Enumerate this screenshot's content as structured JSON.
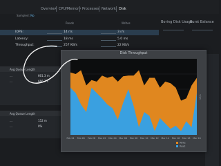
{
  "header": {
    "tabs": [
      {
        "label": "Overview",
        "active": false
      },
      {
        "label": "CPU/Memory",
        "active": false
      },
      {
        "label": "Processes",
        "active": false
      },
      {
        "label": "Network",
        "active": false
      },
      {
        "label": "Disk",
        "active": true
      }
    ],
    "sampled_label": "Sampled:",
    "sampled_value": "No"
  },
  "metrics": {
    "col_reads": "Reads",
    "col_writes": "Writes",
    "rows": [
      {
        "label": "IOPS:",
        "reads": "14 r/s",
        "writes": "3 r/s"
      },
      {
        "label": "Latency:",
        "reads": "18 ms",
        "writes": "5.0 ms"
      },
      {
        "label": "Throughput:",
        "reads": "257 KB/s",
        "writes": "22 KB/s"
      }
    ]
  },
  "right_headers": {
    "boring_disk_usage": "Boring Disk Usage",
    "burst_balance": "Burst Balance"
  },
  "queue_panel": {
    "header": "Avg Queue Length",
    "rows": [
      {
        "label": "…",
        "value": "661.3 m"
      },
      {
        "label": "…",
        "value": "666.7 s"
      }
    ]
  },
  "queue_panel_2": {
    "header": "Avg Queue Length",
    "rows": [
      {
        "label": "…",
        "value": "152 m"
      },
      {
        "label": "…",
        "value": "0%"
      }
    ]
  },
  "modal": {
    "title": "Disk Throughput"
  },
  "chart_data": {
    "type": "area",
    "title": "Disk Throughput",
    "x": [
      "Feb 24",
      "Feb 25",
      "Feb 26",
      "Feb 27",
      "Feb 28",
      "Mar 01",
      "Mar 02",
      "Mar 03",
      "Mar 04",
      "Mar 05",
      "Mar 06",
      "Mar 07",
      "Mar 08",
      "Mar 09",
      "Mar 10",
      "Mar 11",
      "Mar 12",
      "Mar 13",
      "Mar 14",
      "Mar 15",
      "Mar 16",
      "Mar 17",
      "Mar 18",
      "Mar 19",
      "Mar 20"
    ],
    "ylabel": "kB/s",
    "ylim": [
      0,
      1
    ],
    "legend_position": "bottom-right",
    "stacked": true,
    "series": [
      {
        "name": "Read",
        "color": "#3aa0e0",
        "values": [
          0.62,
          0.55,
          0.4,
          0.3,
          0.62,
          0.55,
          0.48,
          0.4,
          0.35,
          0.2,
          0.42,
          0.6,
          0.38,
          0.1,
          0.3,
          0.25,
          0.05,
          0.22,
          0.15,
          0.08,
          0.12,
          0.05,
          0.18,
          0.1,
          0.55
        ]
      },
      {
        "name": "Write",
        "color": "#e0871f",
        "values": [
          0.2,
          0.25,
          0.45,
          0.35,
          0.1,
          0.15,
          0.3,
          0.35,
          0.42,
          0.5,
          0.35,
          0.18,
          0.4,
          0.75,
          0.35,
          0.5,
          0.7,
          0.4,
          0.55,
          0.6,
          0.5,
          0.4,
          0.3,
          0.55,
          0.2
        ]
      }
    ]
  }
}
